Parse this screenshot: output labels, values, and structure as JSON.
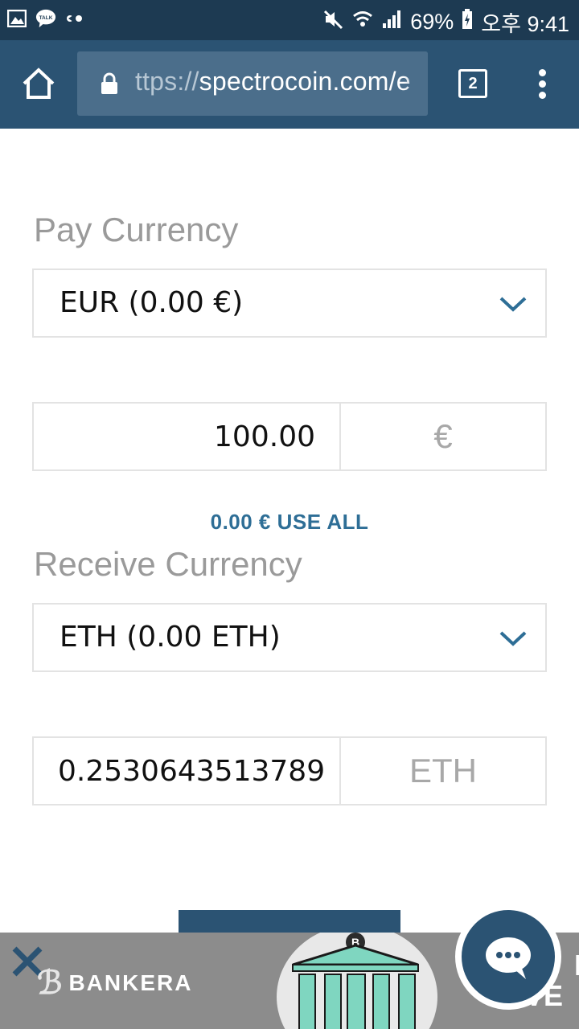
{
  "status_bar": {
    "battery": "69%",
    "time": "오후 9:41",
    "icons": [
      "gallery-icon",
      "kakao-talk-icon",
      "more-notifications-icon",
      "mute-icon",
      "wifi-icon",
      "signal-icon",
      "battery-icon"
    ]
  },
  "browser": {
    "url_prefix": "ttps://",
    "url_main": "spectrocoin.com/e",
    "tab_count": "2"
  },
  "form": {
    "pay_label": "Pay Currency",
    "pay_select": "EUR (0.00 €)",
    "pay_amount": "100.00",
    "pay_unit": "€",
    "use_all": "0.00 € USE ALL",
    "receive_label": "Receive Currency",
    "receive_select": "ETH (0.00 ETH)",
    "receive_amount": "0.2530643513789",
    "receive_unit": "ETH"
  },
  "ad": {
    "brand": "BANKERA",
    "side_text_1": "I",
    "side_text_2": "LIVE"
  },
  "colors": {
    "status_bar": "#1d3a52",
    "toolbar": "#2b5373",
    "accent_link": "#2e6e96",
    "chevron": "#2e6e96"
  }
}
